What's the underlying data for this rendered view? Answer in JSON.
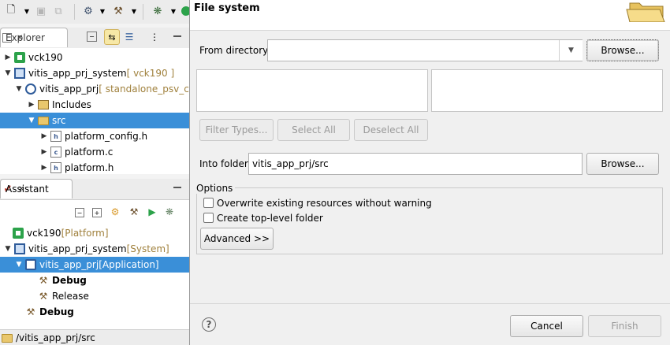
{
  "ide": {
    "explorer": {
      "tab_label": "Explorer",
      "tree": [
        {
          "label": "vck190",
          "decoration": "",
          "icon": "platform-icon",
          "expanded": false
        },
        {
          "label": "vitis_app_prj_system",
          "decoration": " [ vck190 ]",
          "icon": "system-project-icon",
          "expanded": true
        },
        {
          "label": "vitis_app_prj",
          "decoration": " [ standalone_psv_cor",
          "icon": "application-project-icon",
          "expanded": true
        },
        {
          "label": "Includes",
          "icon": "includes-icon",
          "expanded": false
        },
        {
          "label": "src",
          "icon": "folder-icon",
          "expanded": true,
          "selected": true
        },
        {
          "label": "platform_config.h",
          "icon": "h-file-icon"
        },
        {
          "label": "platform.c",
          "icon": "c-file-icon"
        },
        {
          "label": "platform.h",
          "icon": "h-file-icon"
        }
      ]
    },
    "assistant": {
      "tab_label": "Assistant",
      "tree": [
        {
          "label": "vck190",
          "decoration": " [Platform]",
          "icon": "platform-icon"
        },
        {
          "label": "vitis_app_prj_system",
          "decoration": " [System]",
          "icon": "system-project-icon",
          "expanded": true
        },
        {
          "label": "vitis_app_prj",
          "decoration": " [Application]",
          "icon": "application-project-icon",
          "expanded": true,
          "selected": true
        },
        {
          "label": "Debug",
          "icon": "hammer-icon",
          "bold": true
        },
        {
          "label": "Release",
          "icon": "hammer-icon"
        },
        {
          "label": "Debug",
          "icon": "hammer-icon",
          "bold": true
        }
      ]
    },
    "status_path": "/vitis_app_prj/src"
  },
  "dialog": {
    "title": "File system",
    "from_directory_label": "From directory:",
    "from_directory_value": "",
    "browse_label": "Browse...",
    "filter_types_label": "Filter Types...",
    "select_all_label": "Select All",
    "deselect_all_label": "Deselect All",
    "into_folder_label": "Into folder:",
    "into_folder_value": "vitis_app_prj/src",
    "options_label": "Options",
    "overwrite_label": "Overwrite existing resources without warning",
    "overwrite_checked": false,
    "create_top_level_label": "Create top-level folder",
    "create_top_level_checked": false,
    "advanced_label": "Advanced >>",
    "cancel_label": "Cancel",
    "finish_label": "Finish"
  },
  "colors": {
    "selection": "#3a8fd8",
    "decoration": "#a0813d"
  }
}
